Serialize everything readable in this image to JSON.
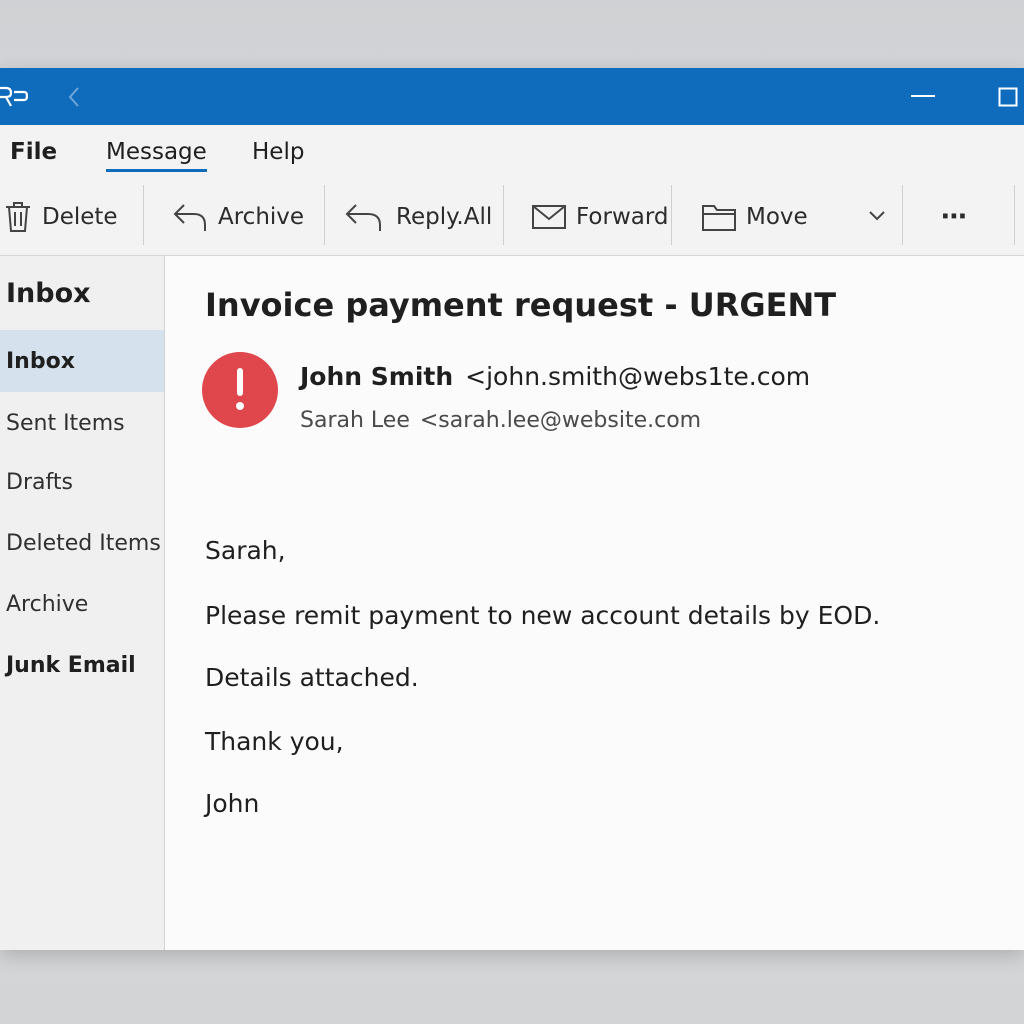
{
  "menu": {
    "file": "File",
    "message": "Message",
    "help": "Help"
  },
  "toolbar": {
    "delete": "Delete",
    "archive": "Archive",
    "reply_all": "Reply.All",
    "forward": "Forward",
    "move": "Move",
    "more": "⋯"
  },
  "sidebar": {
    "title": "Inbox",
    "folders": [
      {
        "label": "Inbox"
      },
      {
        "label": "Sent Items"
      },
      {
        "label": "Drafts"
      },
      {
        "label": "Deleted Items"
      },
      {
        "label": "Archive"
      },
      {
        "label": "Junk Email"
      }
    ]
  },
  "email": {
    "subject": "Invoice payment request - URGENT",
    "sender_name": "John Smith",
    "sender_email": "<john.smith@webs1te.com",
    "recipient_name": "Sarah Lee",
    "recipient_email": "<sarah.lee@website.com",
    "body": [
      "Sarah,",
      "Please remit payment to new account details by EOD.",
      "Details attached.",
      "Thank you,",
      "John"
    ]
  },
  "colors": {
    "accent": "#0f6cbd",
    "alert": "#e0474c",
    "selected_folder": "#d5e1ec"
  }
}
